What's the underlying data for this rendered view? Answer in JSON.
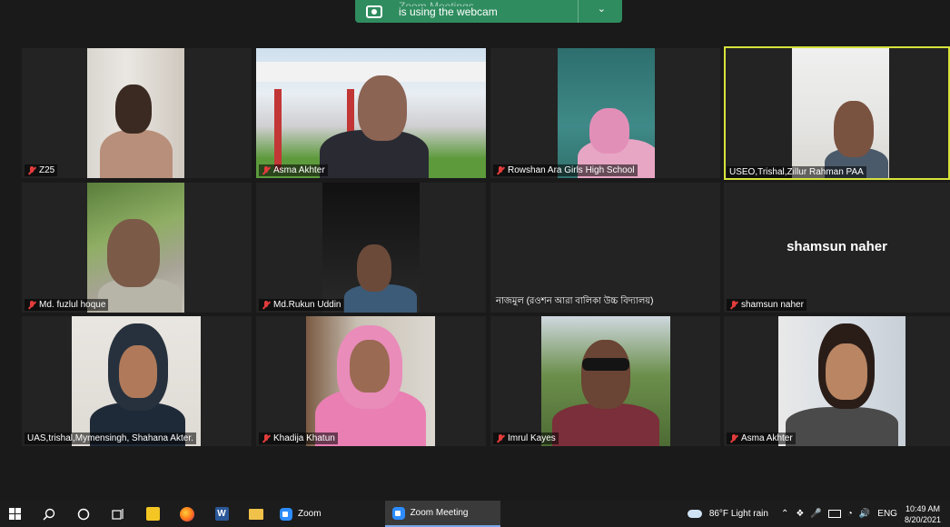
{
  "banner": {
    "line1": "Zoom Meetings",
    "line2": "is using the webcam"
  },
  "tiles": [
    {
      "name": "Z25"
    },
    {
      "name": "Asma Akhter"
    },
    {
      "name": "Rowshan Ara Girls High School"
    },
    {
      "name": "USEO,Trishal,Zillur Rahman PAA"
    },
    {
      "name": "Md. fuzlul hoque"
    },
    {
      "name": "Md.Rukun Uddin"
    },
    {
      "name": "নাজমুল (রওশন আরা বালিকা উচ্চ বিদ্যালয়)"
    },
    {
      "name": "shamsun naher",
      "big": "shamsun naher"
    },
    {
      "name": "UAS,trishal,Mymensingh, Shahana Akter."
    },
    {
      "name": "Khadija Khatun"
    },
    {
      "name": "Imrul Kayes"
    },
    {
      "name": "Asma Akhter"
    }
  ],
  "taskbar": {
    "apps": [
      "Zoom",
      "Zoom Meeting"
    ],
    "weather": "86°F  Light rain",
    "lang": "ENG",
    "time": "10:49 AM",
    "date": "8/20/2021"
  }
}
